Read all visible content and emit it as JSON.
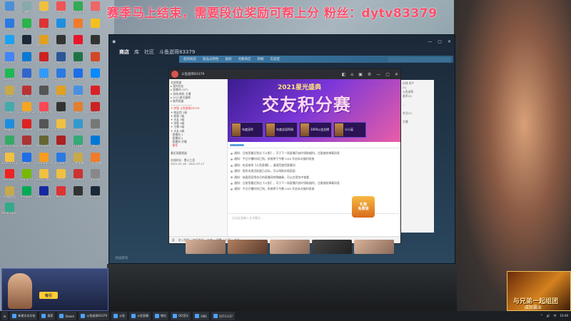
{
  "banner": {
    "text": "赛季马上结束，需要段位奖励可帮上分 粉丝：dytv83379"
  },
  "desktop": {
    "icons": [
      {
        "label": "此电脑",
        "icon": "computer-icon",
        "color": "#4a8fd8"
      },
      {
        "label": "回收站",
        "icon": "recycle-bin-icon",
        "color": "#8aa"
      },
      {
        "label": "文档",
        "icon": "folder-icon",
        "color": "#f0c040"
      },
      {
        "label": "图片",
        "icon": "image-icon",
        "color": "#e55"
      },
      {
        "label": "bandizip",
        "icon": "app-icon",
        "color": "#3a5"
      },
      {
        "label": "BiliBili",
        "icon": "app-icon",
        "color": "#e66"
      },
      {
        "label": "QQ",
        "icon": "qq-icon",
        "color": "#2a7ae2"
      },
      {
        "label": "微信",
        "icon": "wechat-icon",
        "color": "#2cb34a"
      },
      {
        "label": "网易云",
        "icon": "music-icon",
        "color": "#d33"
      },
      {
        "label": "酷狗",
        "icon": "music-icon",
        "color": "#1d8fe0"
      },
      {
        "label": "斗鱼",
        "icon": "app-icon",
        "color": "#f07b2a"
      },
      {
        "label": "YY",
        "icon": "app-icon",
        "color": "#f4c020"
      },
      {
        "label": "Twitter",
        "icon": "twitter-icon",
        "color": "#1da1f2"
      },
      {
        "label": "Steam",
        "icon": "steam-icon",
        "color": "#1b2838"
      },
      {
        "label": "WeGame",
        "icon": "game-icon",
        "color": "#e0a020"
      },
      {
        "label": "Epic",
        "icon": "game-icon",
        "color": "#333"
      },
      {
        "label": "微博",
        "icon": "app-icon",
        "color": "#e6162d"
      },
      {
        "label": "OBS",
        "icon": "app-icon",
        "color": "#333"
      },
      {
        "label": "Chrome",
        "icon": "browser-icon",
        "color": "#4285f4"
      },
      {
        "label": "Edge",
        "icon": "browser-icon",
        "color": "#0a7ad4"
      },
      {
        "label": "WPS",
        "icon": "doc-icon",
        "color": "#c22"
      },
      {
        "label": "Word",
        "icon": "doc-icon",
        "color": "#2b5797"
      },
      {
        "label": "Excel",
        "icon": "doc-icon",
        "color": "#217346"
      },
      {
        "label": "PPT",
        "icon": "doc-icon",
        "color": "#d24726"
      },
      {
        "label": "Spotify",
        "icon": "music-icon",
        "color": "#1db954"
      },
      {
        "label": "网易UU",
        "icon": "app-icon",
        "color": "#3366cc"
      },
      {
        "label": "迅雷",
        "icon": "app-icon",
        "color": "#3399ff"
      },
      {
        "label": "百度网盘",
        "icon": "cloud-icon",
        "color": "#2a7ae2"
      },
      {
        "label": "腾讯会议",
        "icon": "app-icon",
        "color": "#1e6ee8"
      },
      {
        "label": "钉钉",
        "icon": "app-icon",
        "color": "#0a89ff"
      },
      {
        "label": "LOL",
        "icon": "game-icon",
        "color": "#c8a94a"
      },
      {
        "label": "DNF",
        "icon": "game-icon",
        "color": "#b33"
      },
      {
        "label": "CF",
        "icon": "game-icon",
        "color": "#555"
      },
      {
        "label": "PUBG",
        "icon": "game-icon",
        "color": "#e0a020"
      },
      {
        "label": "原神",
        "icon": "game-icon",
        "color": "#4a90e2"
      },
      {
        "label": "Adobe",
        "icon": "app-icon",
        "color": "#da1f26"
      },
      {
        "label": "VPN",
        "icon": "app-icon",
        "color": "#4aa"
      },
      {
        "label": "Counter-Strike",
        "icon": "game-icon",
        "color": "#f5a623"
      },
      {
        "label": "Valorant",
        "icon": "game-icon",
        "color": "#ff4655"
      },
      {
        "label": "GTA",
        "icon": "game-icon",
        "color": "#333"
      },
      {
        "label": "KK",
        "icon": "app-icon",
        "color": "#e08030"
      },
      {
        "label": "WPS Office",
        "icon": "doc-icon",
        "color": "#c22"
      },
      {
        "label": "Kugou",
        "icon": "music-icon",
        "color": "#1d8fe0"
      },
      {
        "label": "Acrobat",
        "icon": "doc-icon",
        "color": "#d22"
      },
      {
        "label": "game-v",
        "icon": "game-icon",
        "color": "#555"
      },
      {
        "label": "2019_11",
        "icon": "folder-icon",
        "color": "#f0c040"
      },
      {
        "label": "Cloud",
        "icon": "cloud-icon",
        "color": "#39c"
      },
      {
        "label": "3D",
        "icon": "app-icon",
        "color": "#777"
      },
      {
        "label": "perfectWorld",
        "icon": "game-icon",
        "color": "#3a6"
      },
      {
        "label": "Naraka",
        "icon": "game-icon",
        "color": "#a33"
      },
      {
        "label": "theGame",
        "icon": "game-icon",
        "color": "#663"
      },
      {
        "label": "Dota2",
        "icon": "game-icon",
        "color": "#a22"
      },
      {
        "label": "1770wa",
        "icon": "app-icon",
        "color": "#3a7"
      },
      {
        "label": "微软",
        "icon": "app-icon",
        "color": "#0078d7"
      },
      {
        "label": "20201102",
        "icon": "folder-icon",
        "color": "#f0c040"
      },
      {
        "label": "腾讯",
        "icon": "app-icon",
        "color": "#1e6ee8"
      },
      {
        "label": "Overwatch",
        "icon": "game-icon",
        "color": "#fa9c1e"
      },
      {
        "label": "Tencent",
        "icon": "app-icon",
        "color": "#2a7ae2"
      },
      {
        "label": "王者荣耀",
        "icon": "game-icon",
        "color": "#c8a94a"
      },
      {
        "label": "斗鱼直播",
        "icon": "app-icon",
        "color": "#f07b2a"
      },
      {
        "label": "Lenovo",
        "icon": "app-icon",
        "color": "#e22"
      },
      {
        "label": "GeForce",
        "icon": "app-icon",
        "color": "#76b900"
      },
      {
        "label": "2020_1016",
        "icon": "folder-icon",
        "color": "#f0c040"
      },
      {
        "label": "data",
        "icon": "folder-icon",
        "color": "#f0c040"
      },
      {
        "label": "Pyramid",
        "icon": "game-icon",
        "color": "#c33"
      },
      {
        "label": "pumb",
        "icon": "app-icon",
        "color": "#888"
      },
      {
        "label": "英雄联盟",
        "icon": "game-icon",
        "color": "#c8a94a"
      },
      {
        "label": "League",
        "icon": "game-icon",
        "color": "#0a5"
      },
      {
        "label": "Samsung",
        "icon": "app-icon",
        "color": "#1428a0"
      },
      {
        "label": "Music",
        "icon": "music-icon",
        "color": "#d33"
      },
      {
        "label": "PICO",
        "icon": "app-icon",
        "color": "#333"
      },
      {
        "label": "Steam2",
        "icon": "steam-icon",
        "color": "#1b2838"
      },
      {
        "label": "Wallpaper",
        "icon": "image-icon",
        "color": "#3a8"
      }
    ]
  },
  "steam": {
    "tabs": [
      "商店",
      "库",
      "社区",
      "斗鱼迦哥83379"
    ],
    "sub_nav": [
      "您的商店",
      "新品与特色",
      "类别",
      "点数商店",
      "新闻",
      "实验室"
    ],
    "window_controls": [
      "—",
      "▢",
      "✕"
    ],
    "footer": "添加游戏"
  },
  "douyu": {
    "title": "斗鱼迦哥83379",
    "tools": [
      "◧",
      "⌂",
      "▣",
      "⚙",
      "—",
      "▢",
      "✕"
    ],
    "left_lines": [
      {
        "text": "全部频道",
        "red": false
      },
      {
        "text": "▸ 我的好友",
        "red": false
      },
      {
        "text": "▸ 直播间 (3/7)",
        "red": false
      },
      {
        "text": "▸ 游戏/单机 主播",
        "red": false
      },
      {
        "text": "▸ 2021星光盛典",
        "red": false
      },
      {
        "text": "▸ 推荐频道",
        "red": false
      },
      {
        "text": "————————",
        "red": false
      },
      {
        "text": "✦ 房管 斗鱼迦哥83379",
        "red": true
      },
      {
        "text": "✦ 粉丝团 1级",
        "red": false
      },
      {
        "text": "✦ 超管 2级",
        "red": false
      },
      {
        "text": "✦ 水友 3级",
        "red": false
      },
      {
        "text": "✦ 游客 4级",
        "red": false
      },
      {
        "text": "✦ 主播 5级",
        "red": false
      },
      {
        "text": "✦ 水友 6级",
        "red": false
      },
      {
        "text": "· 直播间 1",
        "red": false
      },
      {
        "text": "· 直播间 2",
        "red": false
      },
      {
        "text": "· 直播间 开播",
        "red": false
      },
      {
        "text": "· 推荐",
        "red": true
      },
      {
        "text": "",
        "red": false
      },
      {
        "text": "  最近观看频道",
        "red": false
      },
      {
        "text": "",
        "red": false
      },
      {
        "text": "  在线时长 · 累计工资",
        "red": false
      },
      {
        "text": "  2021.01.16  ·  2021.07.17",
        "red": false
      }
    ],
    "banner": {
      "year": "2021星光盛典",
      "title": "交友积分赛",
      "cards": [
        "年度冠军",
        "年度总冠军网",
        "1000公会总榜",
        "小小英"
      ]
    },
    "messages": [
      "通知：日前您最近到达【斗鱼】，可于下一场直播开启时领取福利，注意查收弹幕消息",
      "通知：今日开播时间已到，系统将于今晚 0:00 开启本次福利发放",
      "通知：欢迎来到【斗鱼直播】，请规范使用直播间",
      "通知：您的本周活跃度已达标，可以领取本周奖励",
      "通知：恭喜您获得本月的直播间特殊徽章，可以在背包中查看",
      "通知：日前您最近到达【斗鱼】，可于下一场直播开启时领取福利，注意查收弹幕消息",
      "通知：今日开播时间已到，系统将于今晚 0:00 开启本次福利发放"
    ],
    "input_placeholder": "点击这里输入文字聊天...",
    "bottom_items": [
      "麦",
      "进入频道",
      "房间信息",
      "礼物",
      "设置",
      "分享",
      "关注"
    ],
    "gift_lines": [
      "礼物",
      "免费领"
    ],
    "side_lines": [
      "在线 用户",
      "(1)",
      "斗鱼迦哥",
      "麦序(0)",
      "",
      "...",
      "",
      "关注(2)",
      "",
      "主播"
    ]
  },
  "taskbar": {
    "items": [
      "⊞",
      "新建文本文档",
      "搜索",
      "Steam",
      "斗鱼迦哥83379",
      "斗鱼",
      "斗鱼直播",
      "微信",
      "QQ音乐",
      "OBS",
      "1073-137"
    ],
    "clock": "10:49",
    "tray": [
      "^",
      "🔊",
      "中"
    ]
  },
  "overlays": {
    "cam_tag": "吸引",
    "promo_title": "与兄弟一起组团",
    "promo_sub": "成就霸业"
  }
}
